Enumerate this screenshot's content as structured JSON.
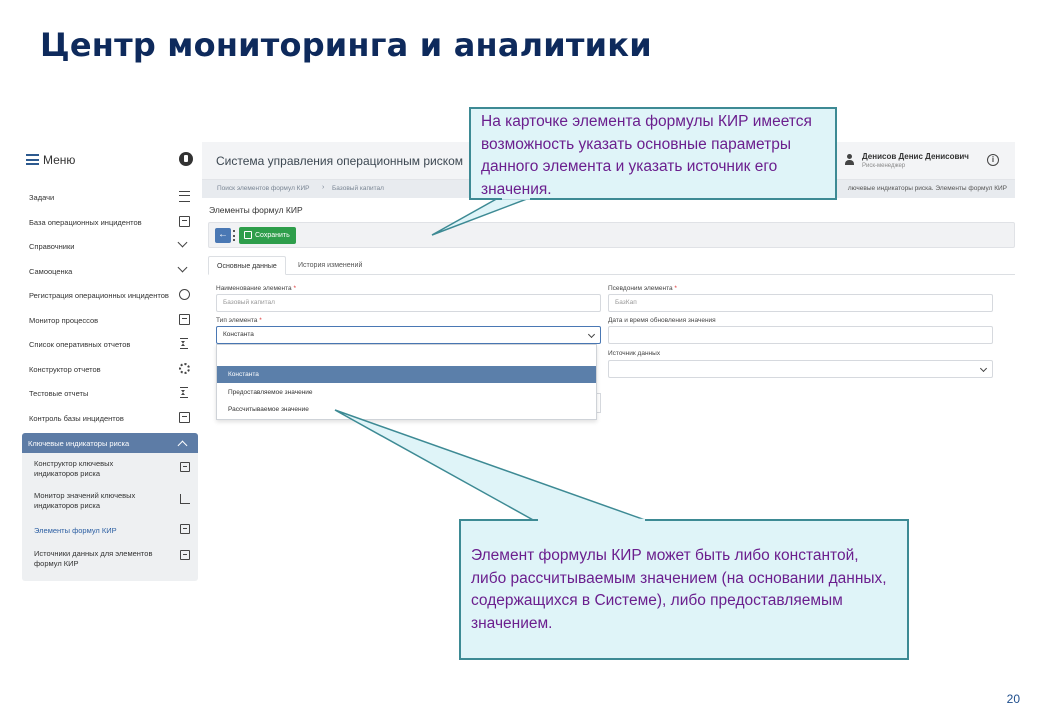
{
  "slide": {
    "title": "Центр мониторинга и аналитики",
    "page_number": "20"
  },
  "sidebar": {
    "menu_label": "Меню",
    "items": [
      {
        "label": "Задачи",
        "icon": "task-list-icon"
      },
      {
        "label": "База операционных инцидентов",
        "icon": "database-icon"
      },
      {
        "label": "Справочники",
        "icon": "chevron-down-icon"
      },
      {
        "label": "Самооценка",
        "icon": "chevron-down-icon"
      },
      {
        "label": "Регистрация операционных инцидентов",
        "icon": "register-icon"
      },
      {
        "label": "Монитор процессов",
        "icon": "monitor-icon"
      },
      {
        "label": "Список оперативных отчетов",
        "icon": "hourglass-icon"
      },
      {
        "label": "Конструктор отчетов",
        "icon": "gears-icon"
      },
      {
        "label": "Тестовые отчеты",
        "icon": "hourglass-icon"
      },
      {
        "label": "Контроль базы инцидентов",
        "icon": "database-icon"
      }
    ],
    "section": {
      "label": "Ключевые индикаторы риска",
      "items": [
        {
          "label": "Конструктор ключевых индикаторов риска",
          "icon": "database-icon"
        },
        {
          "label": "Монитор значений ключевых индикаторов риска",
          "icon": "bar-chart-icon"
        },
        {
          "label": "Элементы формул КИР",
          "icon": "document-icon",
          "active": true
        },
        {
          "label": "Источники данных для элементов формул КИР",
          "icon": "document-icon"
        }
      ]
    }
  },
  "app": {
    "title": "Система управления операционным риском",
    "user_name": "Денисов Денис Денисович",
    "user_role": "Риск-менеджер",
    "breadcrumb": {
      "item1": "Поиск элементов формул КИР",
      "separator": "›",
      "item2": "Базовый капитал",
      "right": "лючевые индикаторы риска. Элементы формул КИР"
    },
    "page_heading": "Элементы формул КИР",
    "toolbar": {
      "save_label": "Сохранить"
    },
    "tabs": [
      "Основные данные",
      "История изменений"
    ],
    "form": {
      "name_label": "Наименование элемента",
      "name_placeholder": "Базовый капитал",
      "alias_label": "Псевдоним элемента",
      "alias_placeholder": "БазКап",
      "type_label": "Тип элемента",
      "type_value": "Константа",
      "date_label": "Дата и время обновления значения",
      "source_label": "Источник данных",
      "required_mark": "*"
    },
    "dropdown_options": [
      "Константа",
      "Предоставляемое значение",
      "Рассчитываемое значение"
    ],
    "colors": {
      "accent": "#4a78b4",
      "save": "#2e9e4b",
      "selected": "#5b7faa"
    }
  },
  "callouts": {
    "top": "На карточке элемента формулы КИР имеется возможность указать основные параметры данного элемента и указать источник его значения.",
    "bottom": "Элемент формулы КИР может быть либо константой, либо рассчитываемым значением (на основании данных, содержащихся в Системе), либо предоставляемым значением.",
    "text_color": "#6b1f8e",
    "fill_color": "#dff4f8",
    "border_color": "#3d8a94"
  }
}
